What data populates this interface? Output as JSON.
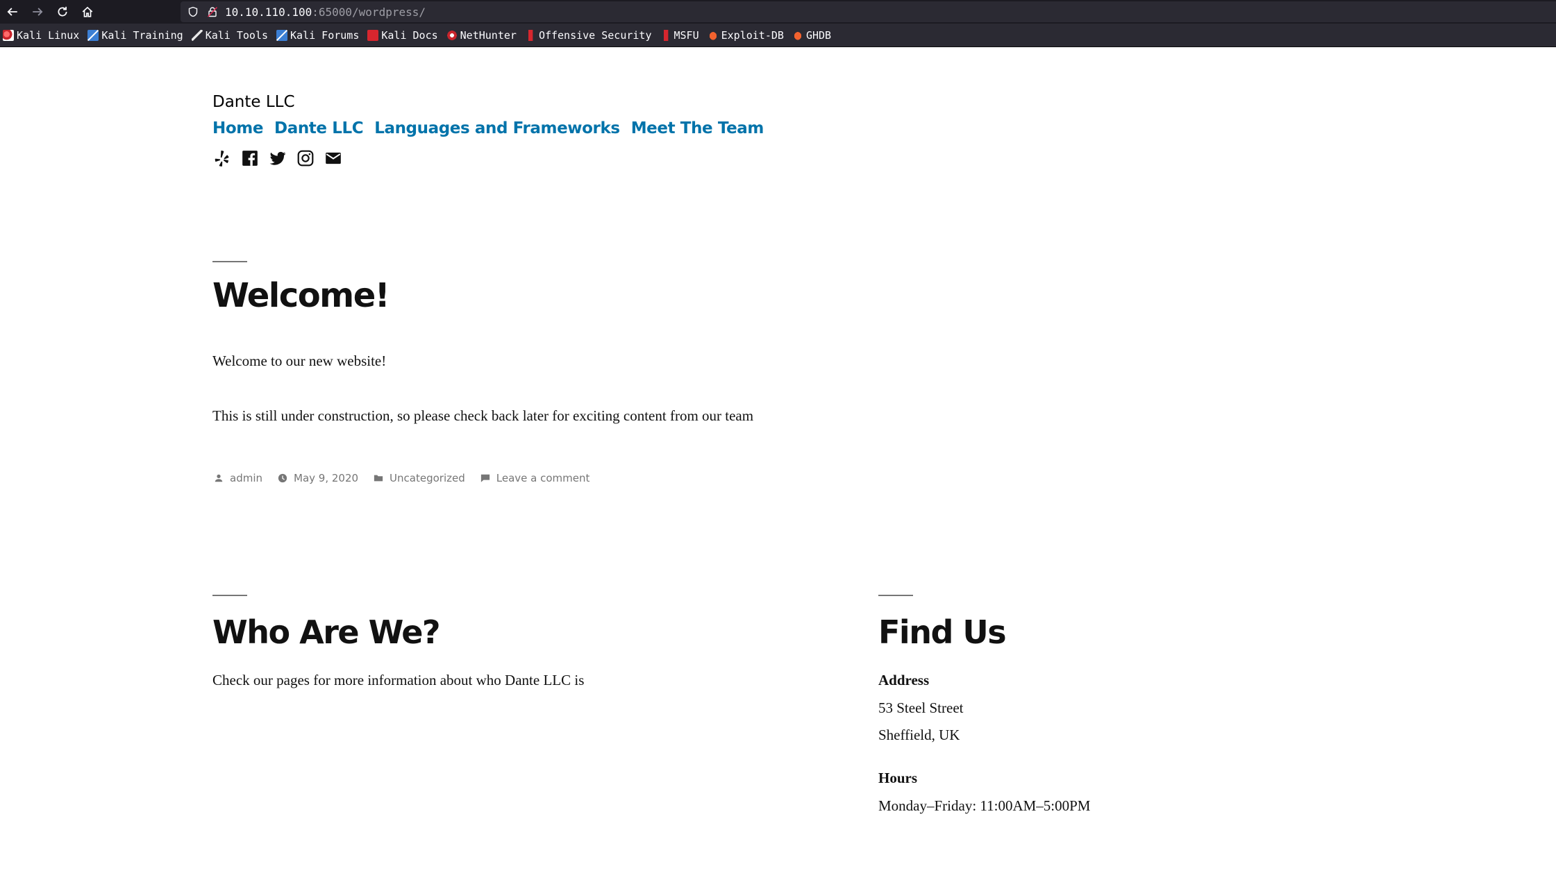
{
  "browser": {
    "url_host": "10.10.110.100",
    "url_rest": ":65000/wordpress/",
    "bookmarks": [
      {
        "label": "Kali Linux",
        "icon": "kali-dragon-icon"
      },
      {
        "label": "Kali Training",
        "icon": "kali-training-icon"
      },
      {
        "label": "Kali Tools",
        "icon": "kali-tools-icon"
      },
      {
        "label": "Kali Forums",
        "icon": "kali-forums-icon"
      },
      {
        "label": "Kali Docs",
        "icon": "kali-docs-icon"
      },
      {
        "label": "NetHunter",
        "icon": "nethunter-icon"
      },
      {
        "label": "Offensive Security",
        "icon": "offensive-security-icon"
      },
      {
        "label": "MSFU",
        "icon": "msfu-icon"
      },
      {
        "label": "Exploit-DB",
        "icon": "exploit-db-icon"
      },
      {
        "label": "GHDB",
        "icon": "ghdb-icon"
      }
    ]
  },
  "site": {
    "title": "Dante LLC",
    "menu": [
      "Home",
      "Dante LLC",
      "Languages and Frameworks",
      "Meet The Team"
    ],
    "social": [
      "yelp-icon",
      "facebook-icon",
      "twitter-icon",
      "instagram-icon",
      "email-icon"
    ]
  },
  "post": {
    "title": "Welcome!",
    "paragraphs": [
      "Welcome to our new website!",
      "This is still under construction, so please check back later for exciting content from our team"
    ],
    "meta": {
      "author": "admin",
      "date": "May 9, 2020",
      "category": "Uncategorized",
      "comments": "Leave a comment"
    }
  },
  "widgets": {
    "about": {
      "title": "Who Are We?",
      "text": "Check our pages for more information about who Dante LLC is"
    },
    "find": {
      "title": "Find Us",
      "address_label": "Address",
      "address_line1": "53 Steel Street",
      "address_line2": "Sheffield, UK",
      "hours_label": "Hours",
      "hours_text": "Monday–Friday: 11:00AM–5:00PM"
    }
  },
  "colors": {
    "link": "#0073aa",
    "text": "#111111",
    "meta": "#767676",
    "chrome_dark": "#1c1b22",
    "chrome_bar": "#2b2a33"
  }
}
